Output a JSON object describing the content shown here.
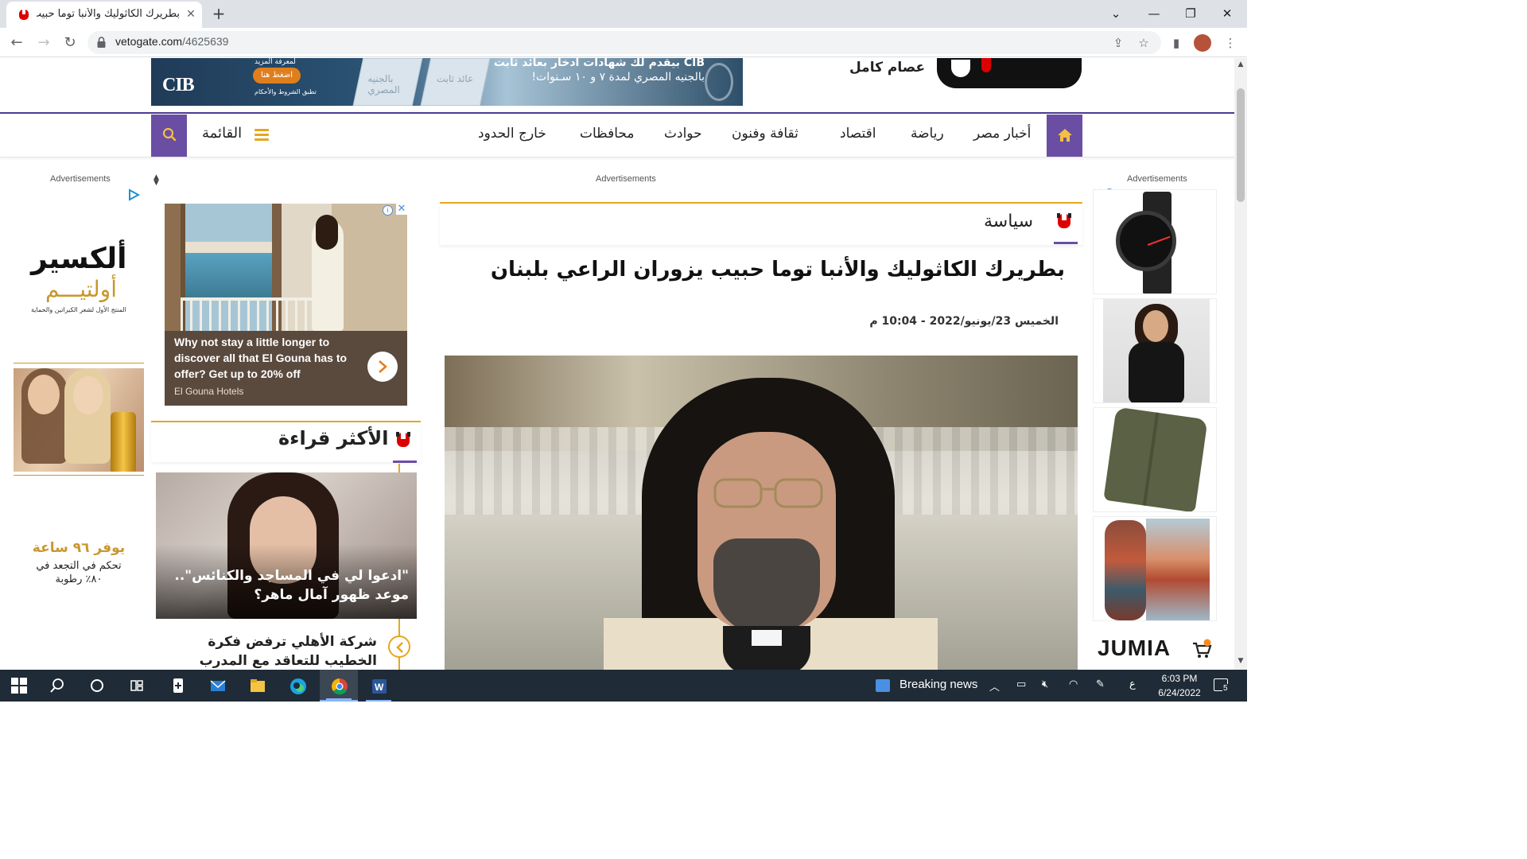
{
  "browser": {
    "tab_title": "بطريرك الكاثوليك والأنبا توما حبيب",
    "url_host": "vetogate.com",
    "url_path": "/4625639"
  },
  "header": {
    "author": "عصام كامل",
    "banner": {
      "bank": "CIB",
      "headline": "CIB بيقدم لك شهادات ادخار بعائد ثابت",
      "subline": "بالجنيه المصري لمدة ٧ و ١٠ سـنوات!",
      "cta_top": "لمعرفة المزيد",
      "cta": "اضغط هنا",
      "terms": "تطبق الشروط والأحكام",
      "block1": "بالجنيه المصري",
      "block2": "عائد ثابت"
    }
  },
  "nav": {
    "menu_label": "القائمة",
    "items": [
      "أخبار مصر",
      "رياضة",
      "اقتصاد",
      "ثقافة وفنون",
      "حوادث",
      "محافظات",
      "خارج الحدود"
    ]
  },
  "ads": {
    "label": "Advertisements",
    "left": {
      "brand": "ألكسير",
      "brand_sub": "أولتيـــم",
      "tagline": "المنتج الأول لشعر الكيراتين والحماية",
      "promo_line1": "يوفر ٩٦ ساعة",
      "promo_line2": "تحكم في التجعد في",
      "promo_line3": "٨٠٪ رطوبة"
    },
    "sponsored": {
      "text": "Why not stay a little longer to discover all that El Gouna has to offer? Get up to 20% off",
      "source": "El Gouna Hotels"
    },
    "right": {
      "brand": "JUMIA"
    }
  },
  "most_read": {
    "title": "الأكثر قراءة",
    "featured": "\"ادعوا لي في المساجد والكنائس\".. موعد ظهور آمال ماهر؟",
    "item": "شركة الأهلي ترفض فكرة الخطيب للتعاقد مع المدرب الجديد"
  },
  "article": {
    "section": "سياسة",
    "title": "بطريرك الكاثوليك والأنبا توما حبيب يزوران الراعي بلبنان",
    "date": "الخميس 23/يونيو/2022 - 10:04 م"
  },
  "taskbar": {
    "news": "Breaking news",
    "lang": "ع",
    "time": "6:03 PM",
    "date": "6/24/2022",
    "notifications": "5"
  },
  "colors": {
    "brand_purple": "#6a4ea3",
    "accent_yellow": "#e7a71c",
    "logo_red": "#d00000"
  }
}
